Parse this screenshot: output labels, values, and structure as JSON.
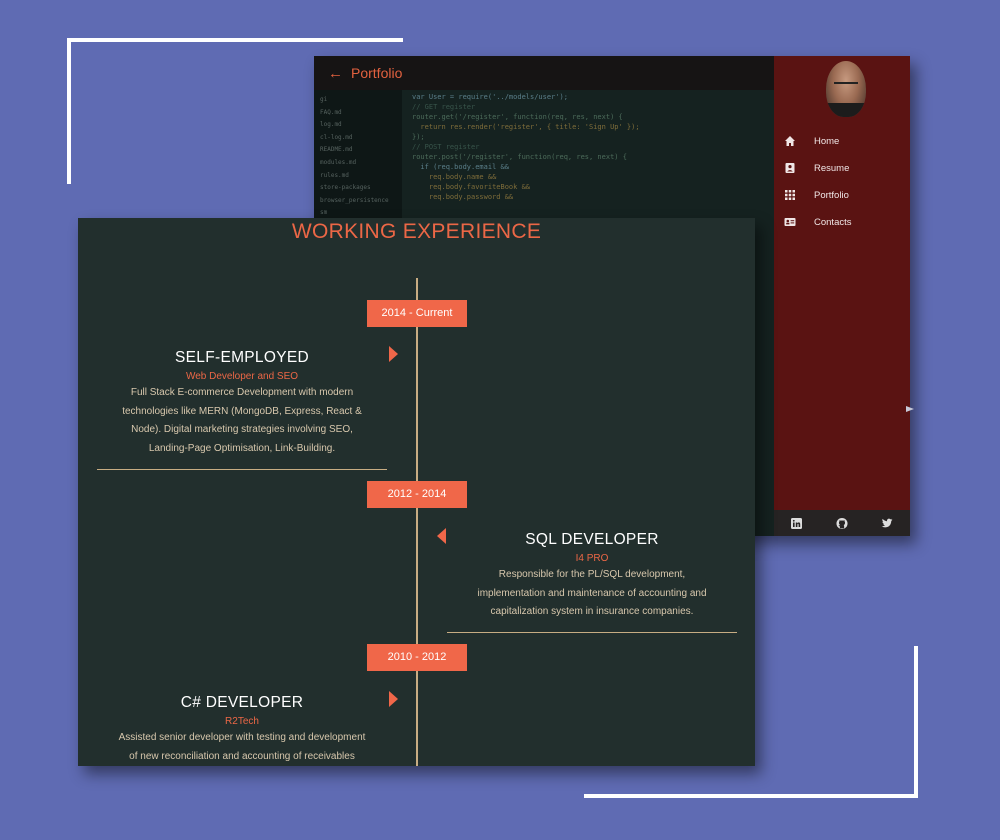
{
  "back_window": {
    "topbar": {
      "back_icon": "arrow-left-icon",
      "title": "Portfolio"
    },
    "file_list": [
      "gi",
      "FAQ.md",
      "log.md",
      "cl-log.md",
      "README.md",
      "modules.md",
      "rules.md",
      "store-packages",
      "browser_persistence",
      "sm"
    ],
    "code_lines": [
      "var User = require('../models/user');",
      "",
      "// GET register",
      "router.get('/register', function(req, res, next) {",
      "  return res.render('register', { title: 'Sign Up' });",
      "});",
      "",
      "// POST register",
      "router.post('/register', function(req, res, next) {",
      "  if (req.body.email &&",
      "    req.body.name &&",
      "    req.body.favoriteBook &&",
      "    req.body.password &&"
    ],
    "sidebar": {
      "avatar_icon": "profile-photo",
      "nav": [
        {
          "label": "Home",
          "icon": "home-icon"
        },
        {
          "label": "Resume",
          "icon": "resume-icon"
        },
        {
          "label": "Portfolio",
          "icon": "grid-icon"
        },
        {
          "label": "Contacts",
          "icon": "contact-card-icon"
        }
      ],
      "social": [
        {
          "label": "in",
          "icon": "linkedin-icon"
        },
        {
          "label": "",
          "icon": "github-icon"
        },
        {
          "label": "",
          "icon": "twitter-icon"
        }
      ]
    }
  },
  "front_panel": {
    "section_title": "WORKING EXPERIENCE",
    "entries": [
      {
        "date": "2014 - Current",
        "title": "SELF-EMPLOYED",
        "company": "Web Developer and SEO",
        "description_lines": [
          "Full Stack E-commerce Development with modern",
          "technologies like MERN (MongoDB, Express, React &",
          "Node). Digital marketing strategies involving SEO,",
          "Landing-Page Optimisation, Link-Building."
        ],
        "side": "left"
      },
      {
        "date": "2012 - 2014",
        "title": "SQL DEVELOPER",
        "company": "I4 PRO",
        "description_lines": [
          "Responsible for the PL/SQL development,",
          "implementation and maintenance of accounting and",
          "capitalization system in insurance companies."
        ],
        "side": "right"
      },
      {
        "date": "2010 - 2012",
        "title": "C# DEVELOPER",
        "company": "R2Tech",
        "description_lines": [
          "Assisted senior developer with testing and development",
          "of new reconciliation and accounting of receivables"
        ],
        "side": "left"
      }
    ]
  },
  "colors": {
    "background": "#5f6bb3",
    "accent": "#f06749",
    "panel": "#222f2d",
    "sidebar": "#5a1312",
    "timeline": "#c8ad83"
  }
}
